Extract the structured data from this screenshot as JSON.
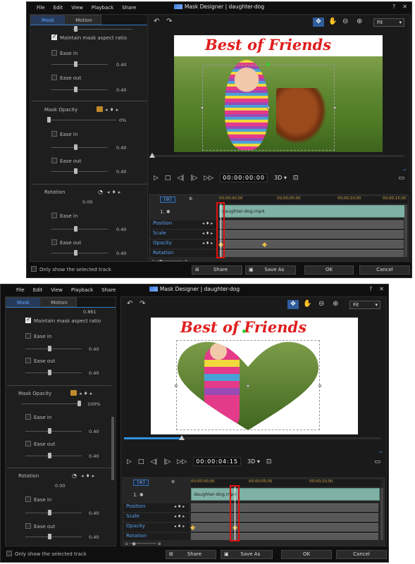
{
  "windows": [
    {
      "menu": [
        "File",
        "Edit",
        "View",
        "Playback",
        "Share"
      ],
      "title": "Mask Designer | daughter-dog",
      "window_controls": [
        "?",
        "✕"
      ],
      "tabs": [
        "Mask",
        "Motion"
      ],
      "left": {
        "maintain_label": "Maintain mask aspect ratio",
        "ease_in_1": "Ease in",
        "ease_in_1_val": "0.40",
        "ease_out_1": "Ease out",
        "ease_out_1_val": "0.40",
        "opacity_label": "Mask Opacity",
        "opacity_val": "0%",
        "ease_in_2": "Ease in",
        "ease_in_2_val": "0.40",
        "ease_out_2": "Ease out",
        "ease_out_2_val": "0.40",
        "rotation_label": "Rotation",
        "rotation_val": "0.00",
        "ease_in_3": "Ease in",
        "ease_in_3_val": "0.40",
        "ease_out_3": "Ease out",
        "ease_out_3_val": "0.40"
      },
      "fit": "Fit",
      "caption": "Best of Friends",
      "timecode": "00:00:00:00",
      "mode3d": "3D ▾",
      "ruler": [
        "00;00;00;00",
        "00;00;05;00",
        "00;00;10;00",
        "00;00;15;00"
      ],
      "track_name": "1.",
      "clip_name": "daughter-dog.mp4",
      "tracks": [
        "Position",
        "Scale",
        "Opacity",
        "Rotation"
      ],
      "only_selected": "Only show the selected track",
      "buttons": {
        "share": "Share",
        "saveas": "Save As",
        "ok": "OK",
        "cancel": "Cancel"
      }
    },
    {
      "menu": [
        "File",
        "Edit",
        "View",
        "Playback",
        "Share"
      ],
      "title": "Mask Designer | daughter-dog",
      "window_controls": [
        "?",
        "✕"
      ],
      "tabs": [
        "Mask",
        "Motion"
      ],
      "left": {
        "top_val": "0.861",
        "maintain_label": "Maintain mask aspect ratio",
        "ease_in_1": "Ease in",
        "ease_in_1_val": "0.40",
        "ease_out_1": "Ease out",
        "ease_out_1_val": "0.40",
        "opacity_label": "Mask Opacity",
        "opacity_val": "100%",
        "ease_in_2": "Ease in",
        "ease_in_2_val": "0.40",
        "ease_out_2": "Ease out",
        "ease_out_2_val": "0.40",
        "rotation_label": "Rotation",
        "rotation_val": "0.00",
        "ease_in_3": "Ease in",
        "ease_in_3_val": "0.40",
        "ease_out_3": "Ease out",
        "ease_out_3_val": "0.40"
      },
      "fit": "Fit",
      "caption": "Best of Friends",
      "timecode": "00:00:04:15",
      "mode3d": "3D ▾",
      "ruler": [
        "00;00;00;00",
        "00;00;05;00",
        "00;00;10;00"
      ],
      "track_name": "1.",
      "clip_name": "daughter-dog.mp4",
      "tracks": [
        "Position",
        "Scale",
        "Opacity",
        "Rotation"
      ],
      "only_selected": "Only show the selected track",
      "buttons": {
        "share": "Share",
        "saveas": "Save As",
        "ok": "OK",
        "cancel": "Cancel"
      }
    }
  ]
}
